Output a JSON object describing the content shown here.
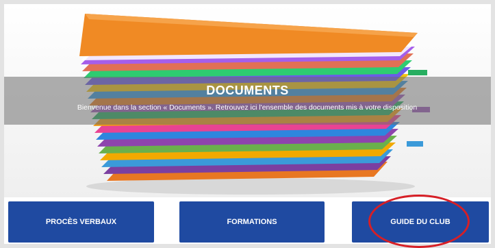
{
  "header": {
    "title": "DOCUMENTS",
    "subtitle": "Bienvenue dans la section « Documents ». Retrouvez ici l'ensemble des documents mis à votre disposition"
  },
  "buttons": [
    {
      "label": "PROCÈS VERBAUX"
    },
    {
      "label": "FORMATIONS"
    },
    {
      "label": "GUIDE DU CLUB"
    }
  ],
  "colors": {
    "button_bg": "#1f4aa1",
    "highlight_circle": "#d61f26",
    "banner_overlay": "#6e6e6e"
  }
}
